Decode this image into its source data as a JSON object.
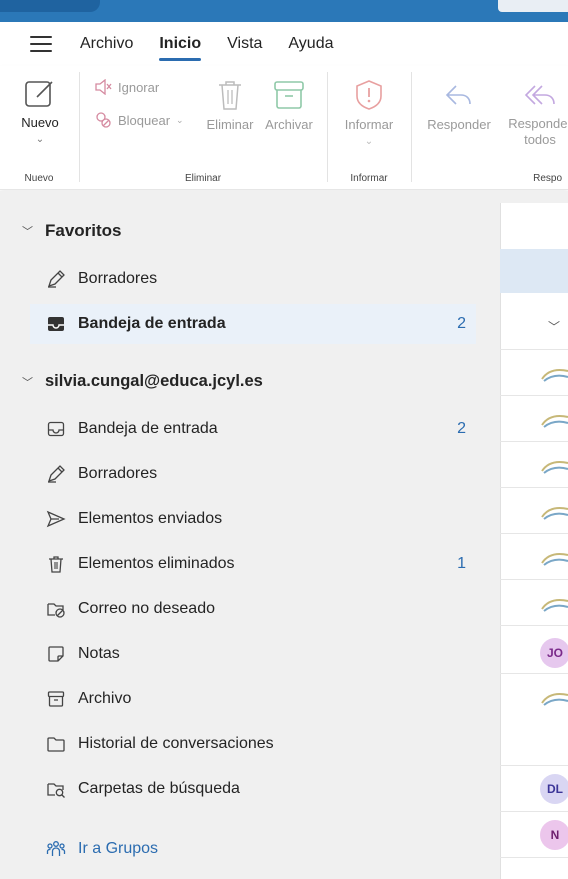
{
  "menu": {
    "tabs": [
      {
        "label": "Archivo"
      },
      {
        "label": "Inicio"
      },
      {
        "label": "Vista"
      },
      {
        "label": "Ayuda"
      }
    ]
  },
  "ribbon": {
    "nuevo": {
      "button": "Nuevo",
      "group": "Nuevo"
    },
    "eliminar": {
      "ignorar": "Ignorar",
      "bloquear": "Bloquear",
      "eliminar": "Eliminar",
      "archivar": "Archivar",
      "group": "Eliminar"
    },
    "informar": {
      "button": "Informar",
      "group": "Informar"
    },
    "responder": {
      "responder": "Responder",
      "responder_todos_1": "Responder",
      "responder_todos_2": "todos",
      "group": "Respo"
    }
  },
  "sidebar": {
    "favorites": {
      "header": "Favoritos",
      "items": [
        {
          "label": "Borradores",
          "icon": "drafts-icon"
        },
        {
          "label": "Bandeja de entrada",
          "icon": "inbox-icon",
          "count": "2"
        }
      ]
    },
    "account": {
      "header": "silvia.cungal@educa.jcyl.es",
      "items": [
        {
          "label": "Bandeja de entrada",
          "icon": "inbox-icon",
          "count": "2"
        },
        {
          "label": "Borradores",
          "icon": "drafts-icon"
        },
        {
          "label": "Elementos enviados",
          "icon": "sent-icon"
        },
        {
          "label": "Elementos eliminados",
          "icon": "trash-icon",
          "count": "1"
        },
        {
          "label": "Correo no deseado",
          "icon": "junk-icon"
        },
        {
          "label": "Notas",
          "icon": "notes-icon"
        },
        {
          "label": "Archivo",
          "icon": "archive-icon"
        },
        {
          "label": "Historial de conversaciones",
          "icon": "folder-icon"
        },
        {
          "label": "Carpetas de búsqueda",
          "icon": "search-folder-icon"
        }
      ]
    },
    "groups_link": "Ir a Grupos"
  },
  "messages": {
    "avatars": [
      "JO",
      "DL",
      "N"
    ]
  },
  "colors": {
    "accent": "#2b6cb0",
    "appbar": "#2b78b8"
  }
}
